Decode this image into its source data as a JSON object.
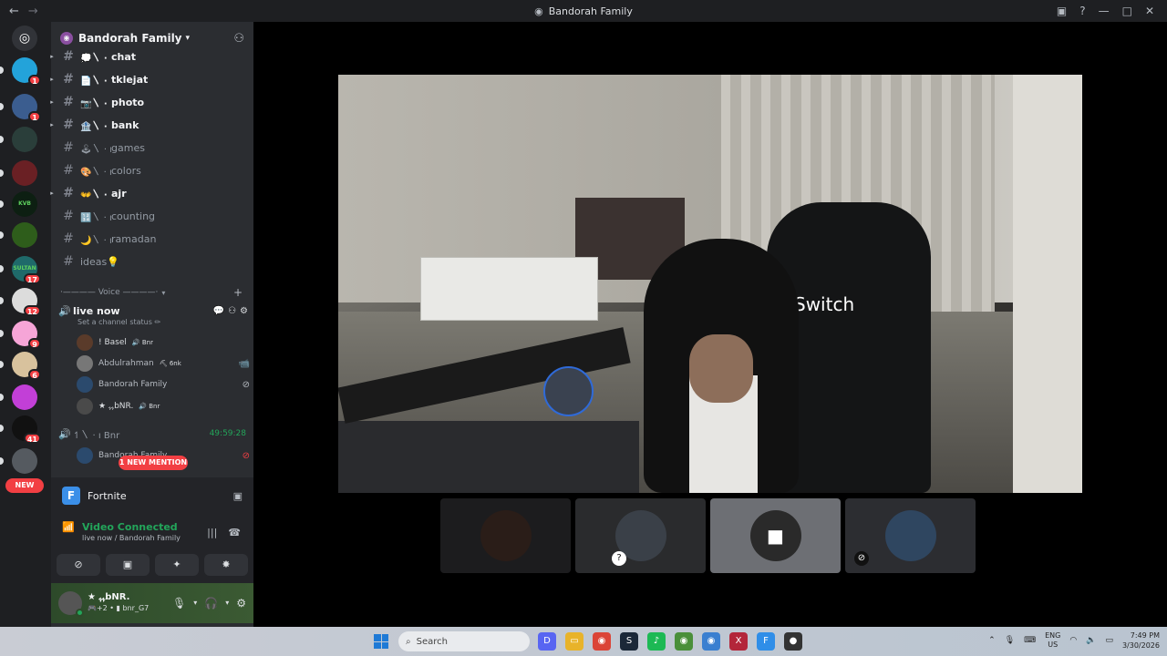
{
  "window": {
    "title": "Bandorah Family",
    "back_glyph": "←",
    "forward_glyph": "→"
  },
  "rail": {
    "new_label": "NEW",
    "badges": [
      "1",
      "1",
      "17",
      "12",
      "9",
      "6",
      "41"
    ],
    "servers": [
      {
        "label": "",
        "color": "#3a3c43"
      },
      {
        "label": "",
        "color": "#23a3da"
      },
      {
        "label": "",
        "color": "#3b5d8f"
      },
      {
        "label": "",
        "color": "#2a3e3a"
      },
      {
        "label": "",
        "color": "#6a2024"
      },
      {
        "label": "KVB",
        "color": "#0d1f12"
      },
      {
        "label": "",
        "color": "#2e5d1b"
      },
      {
        "label": "SULTAN",
        "color": "#1f6a6a"
      },
      {
        "label": "",
        "color": "#dcdcdc"
      },
      {
        "label": "",
        "color": "#f6a5d7"
      },
      {
        "label": "",
        "color": "#d8c29d"
      },
      {
        "label": "",
        "color": "#c23fd7"
      },
      {
        "label": "",
        "color": "#111111"
      },
      {
        "label": "",
        "color": "#555a60"
      }
    ]
  },
  "guild": {
    "name": "Bandorah Family"
  },
  "channels": [
    {
      "emoji": "💭〵 · ı",
      "name": "chat",
      "unread": true
    },
    {
      "emoji": "📄〵 · ı",
      "name": "tklejat",
      "unread": true
    },
    {
      "emoji": "📷〵 · ı",
      "name": "photo",
      "unread": true
    },
    {
      "emoji": "🏦〵 · ı",
      "name": "bank",
      "unread": true
    },
    {
      "emoji": "🕹〵 · ı",
      "name": "games",
      "unread": false
    },
    {
      "emoji": "🎨〵 · ı",
      "name": "colors",
      "unread": false
    },
    {
      "emoji": "👐〵 · ı",
      "name": "ajr",
      "unread": true
    },
    {
      "emoji": "🔢〵 · ı",
      "name": "counting",
      "unread": false
    },
    {
      "emoji": "🌙〵 · ı",
      "name": "ramadan",
      "unread": false
    },
    {
      "emoji": "",
      "name": "ideas💡",
      "unread": false
    }
  ],
  "voice": {
    "category": "·———— Voice ————·",
    "channel_name": "live now",
    "channel_status": "Set a channel status ✏",
    "users": [
      {
        "name": "! Basel",
        "tag": "🔊 Bnr",
        "color": "#5a3b2a",
        "icon": ""
      },
      {
        "name": "Abdulrahman",
        "tag": "⛏ 6nk",
        "color": "#777777",
        "icon": "📹"
      },
      {
        "name": "Bandorah Family",
        "tag": "",
        "color": "#2b4a6d",
        "icon": "⊘"
      },
      {
        "name": "★ ﮩﮩbNR.",
        "tag": "🔊 Bnr",
        "color": "#4a4a4a",
        "icon": ""
      }
    ],
    "channel2_name": "↿〵 · ı Bnr",
    "timer": "49:59:28",
    "channel2_user": "Bandorah Family",
    "mention": "1 NEW MENTION"
  },
  "game": {
    "name": "Fortnite"
  },
  "connection": {
    "status": "Video Connected",
    "detail": "live now / Bandorah Family"
  },
  "user": {
    "display": "★ ﮩﮩbNR.",
    "sub": "🎮+2 • ▮ bnr_G7"
  },
  "tiles": [
    {
      "color": "#2a1d18"
    },
    {
      "color": "#3a4048"
    },
    {
      "color": "#2a2a2a"
    },
    {
      "color": "#2f4660"
    }
  ],
  "taskbar": {
    "search_placeholder": "Search",
    "lang_1": "ENG",
    "lang_2": "US",
    "time": "7:49 PM",
    "date": "3/30/2026",
    "apps": [
      {
        "label": "D",
        "color": "#5865f2"
      },
      {
        "label": "▭",
        "color": "#e8b32a"
      },
      {
        "label": "◉",
        "color": "#db4437"
      },
      {
        "label": "S",
        "color": "#1b2838"
      },
      {
        "label": "♪",
        "color": "#1db954"
      },
      {
        "label": "◉",
        "color": "#4a8f3a"
      },
      {
        "label": "◉",
        "color": "#3a7fd0"
      },
      {
        "label": "X",
        "color": "#b3263a"
      },
      {
        "label": "F",
        "color": "#2f8ee8"
      },
      {
        "label": "●",
        "color": "#333333"
      }
    ]
  }
}
